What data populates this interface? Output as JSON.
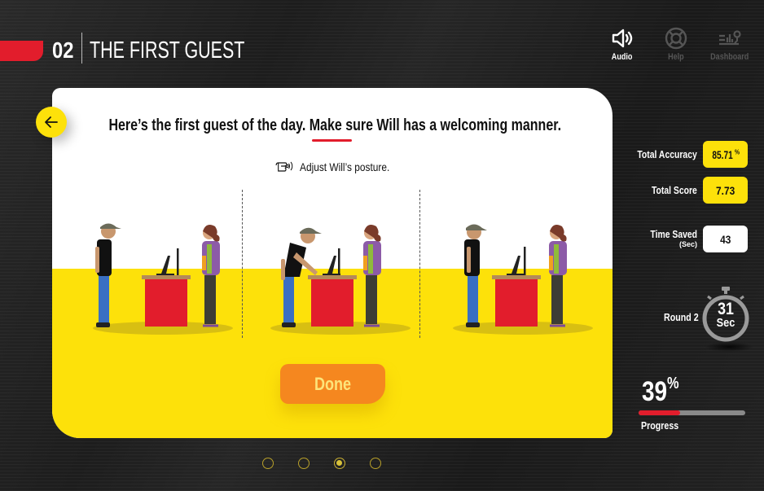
{
  "header": {
    "episode_number": "02",
    "episode_title": "THE FIRST GUEST"
  },
  "top_nav": [
    {
      "label": "Audio",
      "icon": "speaker-icon",
      "enabled": true
    },
    {
      "label": "Help",
      "icon": "lifebuoy-icon",
      "enabled": false
    },
    {
      "label": "Dashboard",
      "icon": "dashboard-icon",
      "enabled": false
    }
  ],
  "activity": {
    "instruction": "Here’s the first guest of the day. Make sure Will has a welcoming manner.",
    "hint_icon": "pointing-hand-icon",
    "hint": "Adjust Will’s posture.",
    "options": [
      {
        "id": "option-1",
        "description": "Will standing upright facing guest"
      },
      {
        "id": "option-2",
        "description": "Will leaning on counter"
      },
      {
        "id": "option-3",
        "description": "Will standing upright, head tilted"
      }
    ],
    "done_label": "Done",
    "back_icon": "arrow-left-icon"
  },
  "stats": {
    "total_accuracy_label": "Total Accuracy",
    "total_accuracy_value": "85.71",
    "total_accuracy_unit": "%",
    "total_score_label": "Total Score",
    "total_score_value": "7.73",
    "time_saved_label": "Time Saved",
    "time_saved_sub": "(Sec)",
    "time_saved_value": "43",
    "round_label": "Round 2",
    "timer_value": "31",
    "timer_unit": "Sec",
    "progress_value": "39",
    "progress_unit": "%",
    "progress_fraction": 0.39,
    "progress_label": "Progress"
  },
  "pagination": {
    "total": 4,
    "active_index": 2
  },
  "colors": {
    "brand_red": "#e21d2c",
    "brand_yellow": "#fde10a",
    "done_orange": "#f5871f"
  }
}
